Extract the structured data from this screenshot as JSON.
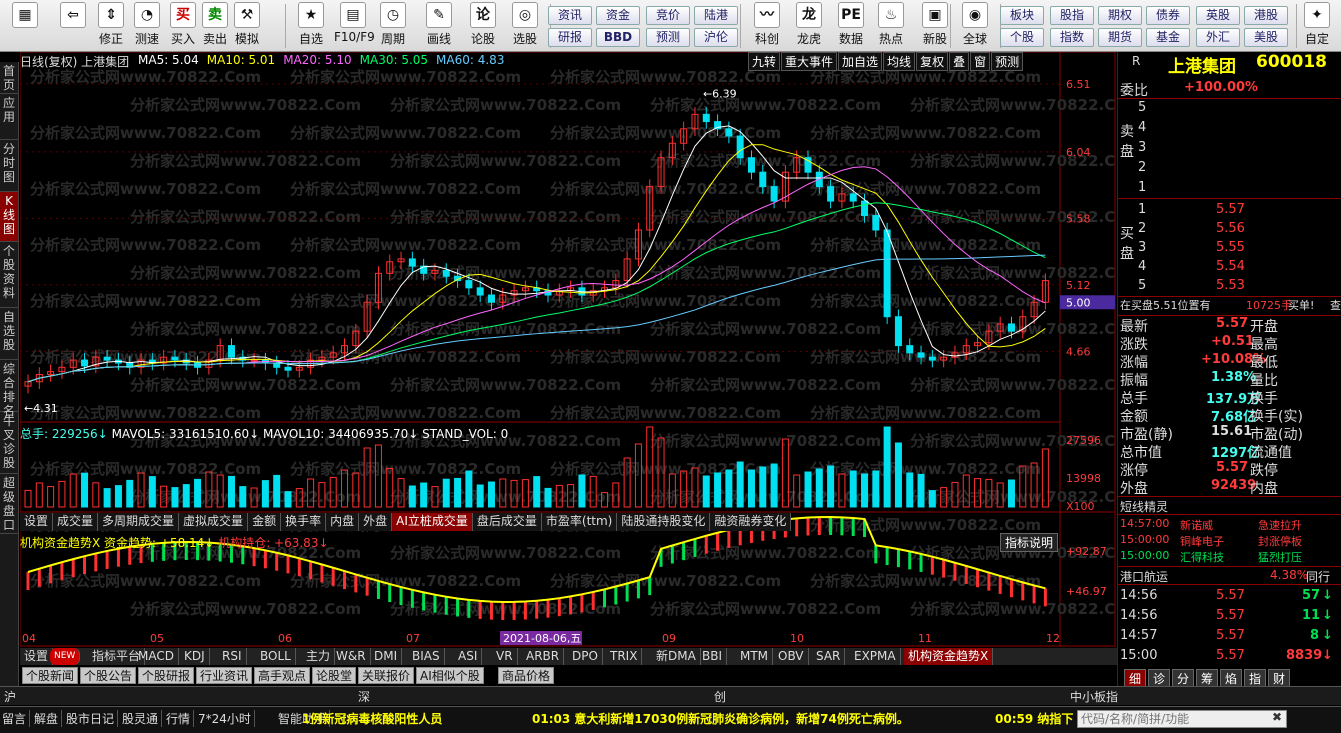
{
  "toolbar": {
    "buttons": [
      {
        "label": "",
        "icon": "grid-icon"
      },
      {
        "label": "",
        "icon": "back-arrow-icon"
      },
      {
        "label": "修正",
        "icon": "updown-icon"
      },
      {
        "label": "测速",
        "icon": "clock-icon"
      },
      {
        "label": "买入",
        "icon": "buy-icon"
      },
      {
        "label": "卖出",
        "icon": "sell-icon"
      },
      {
        "label": "模拟",
        "icon": "hammer-icon"
      },
      {
        "label": "自选",
        "icon": "star-icon"
      },
      {
        "label": "F10/F9",
        "icon": "f10-icon"
      },
      {
        "label": "周期",
        "icon": "cycle-icon"
      },
      {
        "label": "画线",
        "icon": "pen-icon"
      },
      {
        "label": "论股",
        "icon": "talk-icon"
      },
      {
        "label": "选股",
        "icon": "pick-icon"
      },
      {
        "label": "科创",
        "icon": "kechuang-icon"
      },
      {
        "label": "龙虎",
        "icon": "dragon-icon"
      },
      {
        "label": "数据",
        "icon": "pe-icon"
      },
      {
        "label": "热点",
        "icon": "fire-icon"
      },
      {
        "label": "新股",
        "icon": "newstock-icon"
      },
      {
        "label": "全球",
        "icon": "globe-icon"
      },
      {
        "label": "自定",
        "icon": "custom-icon"
      }
    ],
    "quick_row1": [
      "资讯",
      "资金",
      "竞价",
      "陆港",
      "板块",
      "股指",
      "期权",
      "债券",
      "英股",
      "港股"
    ],
    "quick_row2": [
      "研报",
      "BBD",
      "预测",
      "沪伦",
      "个股",
      "指数",
      "期货",
      "基金",
      "外汇",
      "美股"
    ]
  },
  "leftnav": [
    "首页",
    "应用",
    "分时图",
    "K线图",
    "个股资料",
    "自选股",
    "综合排名",
    "牛叉诊股",
    "超级盘口"
  ],
  "chart": {
    "header": "日线(复权) 上港集团",
    "ma": [
      {
        "name": "MA5: 5.04",
        "color": "#ffffff"
      },
      {
        "name": "MA10: 5.01",
        "color": "#ffff00"
      },
      {
        "name": "MA20: 5.10",
        "color": "#ff66ff"
      },
      {
        "name": "MA30: 5.05",
        "color": "#00ff66"
      },
      {
        "name": "MA60: 4.83",
        "color": "#66ccff"
      }
    ],
    "top_buttons": [
      "九转",
      "重大事件",
      "加自选",
      "均线",
      "复权",
      "叠",
      "窗",
      "预测"
    ],
    "price_labels": [
      "6.51",
      "6.04",
      "5.58",
      "5.12",
      "4.66"
    ],
    "current_price": "5.00",
    "high_label": "6.39",
    "low_label": "4.31",
    "vol_header": {
      "a": "总手: 229256↓",
      "b": "MAVOL5: 33161510.60↓",
      "c": "MAVOL10: 34406935.70↓",
      "d": "STAND_VOL: 0"
    },
    "vol_labels": [
      "27596",
      "13998",
      "X100"
    ],
    "sub_tabs": [
      "设置",
      "成交量",
      "多周期成交量",
      "虚拟成交量",
      "金额",
      "换手率",
      "内盘",
      "外盘",
      "AI立桩成交量",
      "盘后成交量",
      "市盈率(ttm)",
      "陆股通持股变化",
      "融资融券变化"
    ],
    "ind_header": {
      "a": "机构资金趋势X 资金趋势: +58.14↓",
      "b": "机构持仓: +63.83↓"
    },
    "ind_button": "指标说明",
    "ind_labels": [
      "+92.87",
      "+46.97"
    ],
    "months": [
      "04",
      "05",
      "06",
      "07",
      "08",
      "09",
      "10",
      "11",
      "12"
    ],
    "date_marker": "2021-08-06,五",
    "watermark": "分析家公式网www.70822.Com"
  },
  "chart_data": {
    "type": "candlestick",
    "x_range": [
      "2021-03",
      "2021-12"
    ],
    "ylim": [
      4.31,
      6.51
    ],
    "high": 6.39,
    "low": 4.31,
    "ma": {
      "MA5": 5.04,
      "MA10": 5.01,
      "MA20": 5.1,
      "MA30": 5.05,
      "MA60": 4.83
    },
    "close_series": [
      4.45,
      4.5,
      4.52,
      4.55,
      4.6,
      4.56,
      4.62,
      4.6,
      4.58,
      4.55,
      4.6,
      4.58,
      4.62,
      4.6,
      4.58,
      4.55,
      4.6,
      4.7,
      4.62,
      4.6,
      4.6,
      4.58,
      4.55,
      4.53,
      4.55,
      4.6,
      4.62,
      4.65,
      4.7,
      4.8,
      5.0,
      5.2,
      5.28,
      5.3,
      5.25,
      5.2,
      5.22,
      5.18,
      5.15,
      5.1,
      5.05,
      5.0,
      5.05,
      5.08,
      5.1,
      5.08,
      5.05,
      5.08,
      5.1,
      5.05,
      5.08,
      5.1,
      5.15,
      5.3,
      5.5,
      5.8,
      6.0,
      6.1,
      6.2,
      6.3,
      6.25,
      6.2,
      6.15,
      6.0,
      5.9,
      5.8,
      5.7,
      5.9,
      6.0,
      5.9,
      5.8,
      5.7,
      5.75,
      5.7,
      5.6,
      5.5,
      4.9,
      4.7,
      4.65,
      4.62,
      4.6,
      4.62,
      4.65,
      4.7,
      4.72,
      4.8,
      4.85,
      4.8,
      4.9,
      5.0,
      5.15
    ]
  },
  "side": {
    "title": "上港集团",
    "code": "600018",
    "r": "R",
    "weibi_label": "委比",
    "weibi": "+100.00%",
    "sell": [
      "5",
      "4",
      "3",
      "2",
      "1"
    ],
    "sell_label": "卖盘",
    "buy": [
      {
        "n": "1",
        "p": "5.57"
      },
      {
        "n": "2",
        "p": "5.56"
      },
      {
        "n": "3",
        "p": "5.55"
      },
      {
        "n": "4",
        "p": "5.54"
      },
      {
        "n": "5",
        "p": "5.53"
      }
    ],
    "buy_label": "买盘",
    "zaimai": "在买盘5.51位置有",
    "zaimai_vol": "10725手",
    "zaimai_tail": "买单!",
    "zaimai_end": "查",
    "stats": [
      {
        "l": "最新",
        "v": "5.57",
        "c": "red",
        "r": "开盘"
      },
      {
        "l": "涨跌",
        "v": "+0.51",
        "c": "red",
        "r": "最高"
      },
      {
        "l": "涨幅",
        "v": "+10.08%",
        "c": "red",
        "r": "最低"
      },
      {
        "l": "振幅",
        "v": "1.38%",
        "c": "cy",
        "r": "量比"
      },
      {
        "l": "总手",
        "v": "137.9万",
        "c": "cy",
        "r": "换手"
      },
      {
        "l": "金额",
        "v": "7.68亿",
        "c": "cy",
        "r": "换手(实)"
      },
      {
        "l": "市盈(静)",
        "v": "15.61",
        "c": "wh",
        "r": "市盈(动)"
      },
      {
        "l": "总市值",
        "v": "1297亿",
        "c": "cy",
        "r": "流通值"
      },
      {
        "l": "涨停",
        "v": "5.57",
        "c": "red",
        "r": "跌停"
      },
      {
        "l": "外盘",
        "v": "92439",
        "c": "red",
        "r": "内盘"
      }
    ],
    "stats_right": [
      "1"
    ],
    "sprite_title": "短线精灵",
    "sprite": [
      {
        "t": "14:57:00",
        "n": "新诺威",
        "e": "急速拉升",
        "c": "red"
      },
      {
        "t": "15:00:00",
        "n": "铜峰电子",
        "e": "封涨停板",
        "c": "red"
      },
      {
        "t": "15:00:00",
        "n": "汇得科技",
        "e": "猛烈打压",
        "c": "grn"
      }
    ],
    "hk_name": "港口航运",
    "hk_pct": "4.38%",
    "hk_right": "同行",
    "ticks": [
      {
        "t": "14:56",
        "p": "5.57",
        "v": "57",
        "arrow": "↓",
        "c": "grn"
      },
      {
        "t": "14:56",
        "p": "5.57",
        "v": "11",
        "arrow": "↓",
        "c": "grn"
      },
      {
        "t": "14:57",
        "p": "5.57",
        "v": "8",
        "arrow": "↓",
        "c": "grn"
      },
      {
        "t": "15:00",
        "p": "5.57",
        "v": "8839",
        "arrow": "↓",
        "c": "red"
      }
    ],
    "bottom_tabs": [
      "细",
      "诊",
      "分",
      "筹",
      "焰",
      "指",
      "财"
    ]
  },
  "bottom_tabs": [
    "设置",
    "NEW",
    "指标平台",
    "MACD",
    "KDJ",
    "RSI",
    "BOLL",
    "主力",
    "W&R",
    "DMI",
    "BIAS",
    "ASI",
    "VR",
    "ARBR",
    "DPO",
    "TRIX",
    "新DMA",
    "BBI",
    "MTM",
    "OBV",
    "SAR",
    "EXPMA",
    "机构资金趋势X"
  ],
  "news_tabs": [
    "个股新闻",
    "个股公告",
    "个股研报",
    "行业资讯",
    "高手观点",
    "论股堂",
    "关联报价",
    "AI相似个股",
    "商品价格"
  ],
  "index_bar": {
    "a": "沪",
    "b": "深",
    "c": "创",
    "d": "中小板指"
  },
  "status": {
    "items": [
      "留言",
      "解盘",
      "股市日记",
      "股灵通",
      "行情",
      "7*24小时",
      "智能助手"
    ],
    "ticker1": "1例新冠病毒核酸阳性人员",
    "ticker2": "01:03 意大利新增17030例新冠肺炎确诊病例，新增74例死亡病例。",
    "ticker3": "00:59 纳指下",
    "search_placeholder": "代码/名称/简拼/功能"
  }
}
